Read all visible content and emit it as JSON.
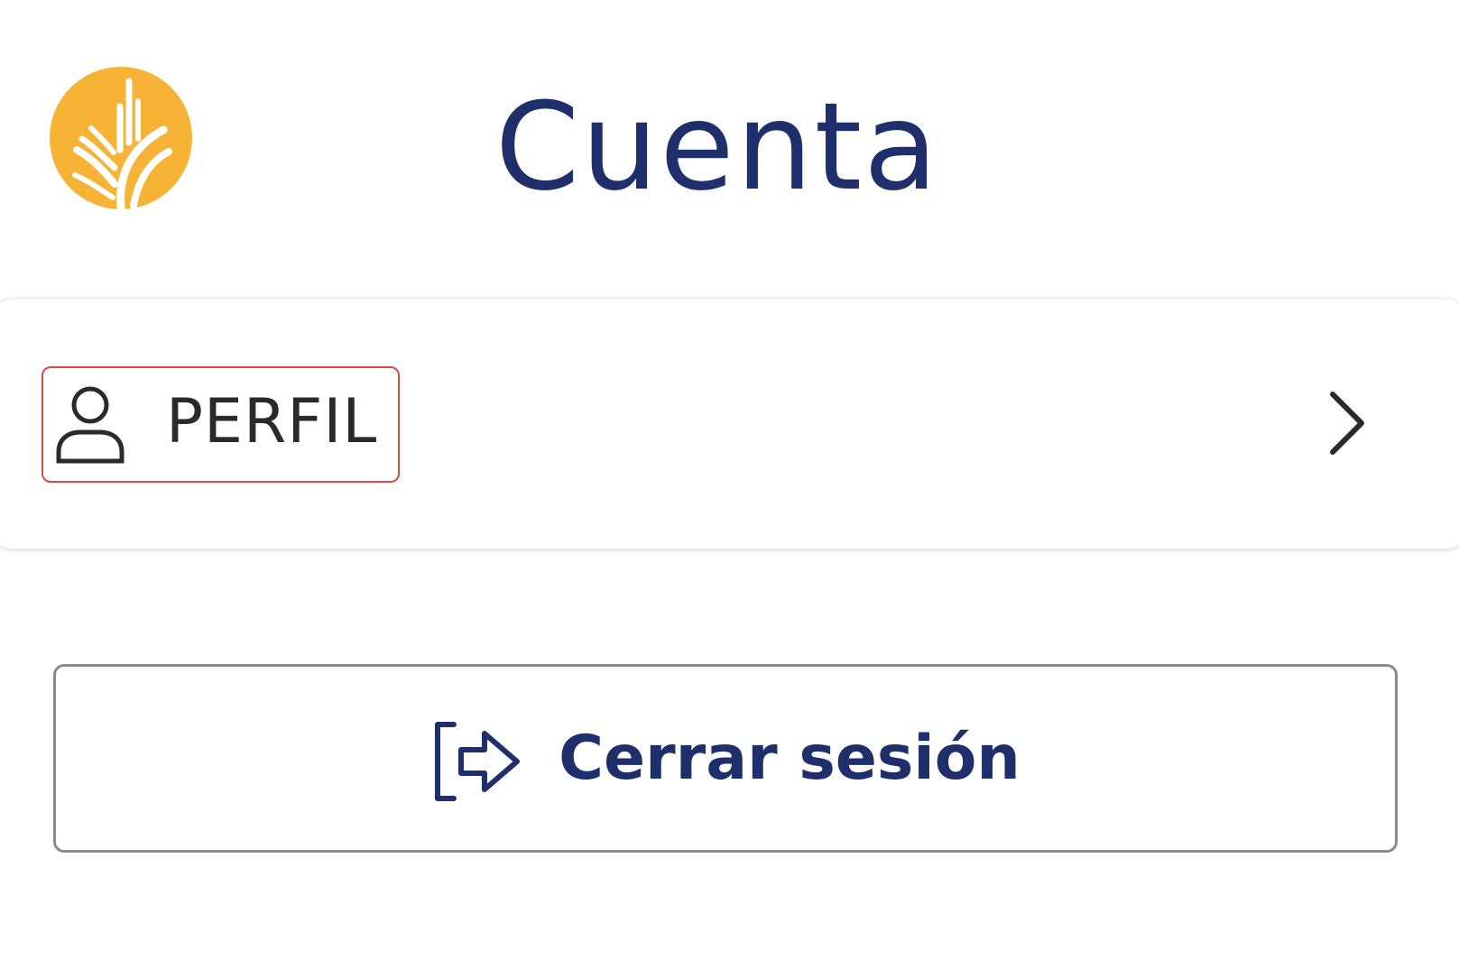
{
  "header": {
    "logo": {
      "icon": "wheat-logo-icon",
      "color": "#f6b335"
    },
    "title": "Cuenta"
  },
  "menu": {
    "items": [
      {
        "icon": "user-icon",
        "label": "PERFIL",
        "trailing_icon": "chevron-right-icon",
        "highlighted": true
      }
    ]
  },
  "logout": {
    "icon": "logout-icon",
    "label": "Cerrar sesión"
  },
  "colors": {
    "primary": "#1f2f6b",
    "accent": "#f6b335",
    "highlight": "#dc4a42"
  }
}
